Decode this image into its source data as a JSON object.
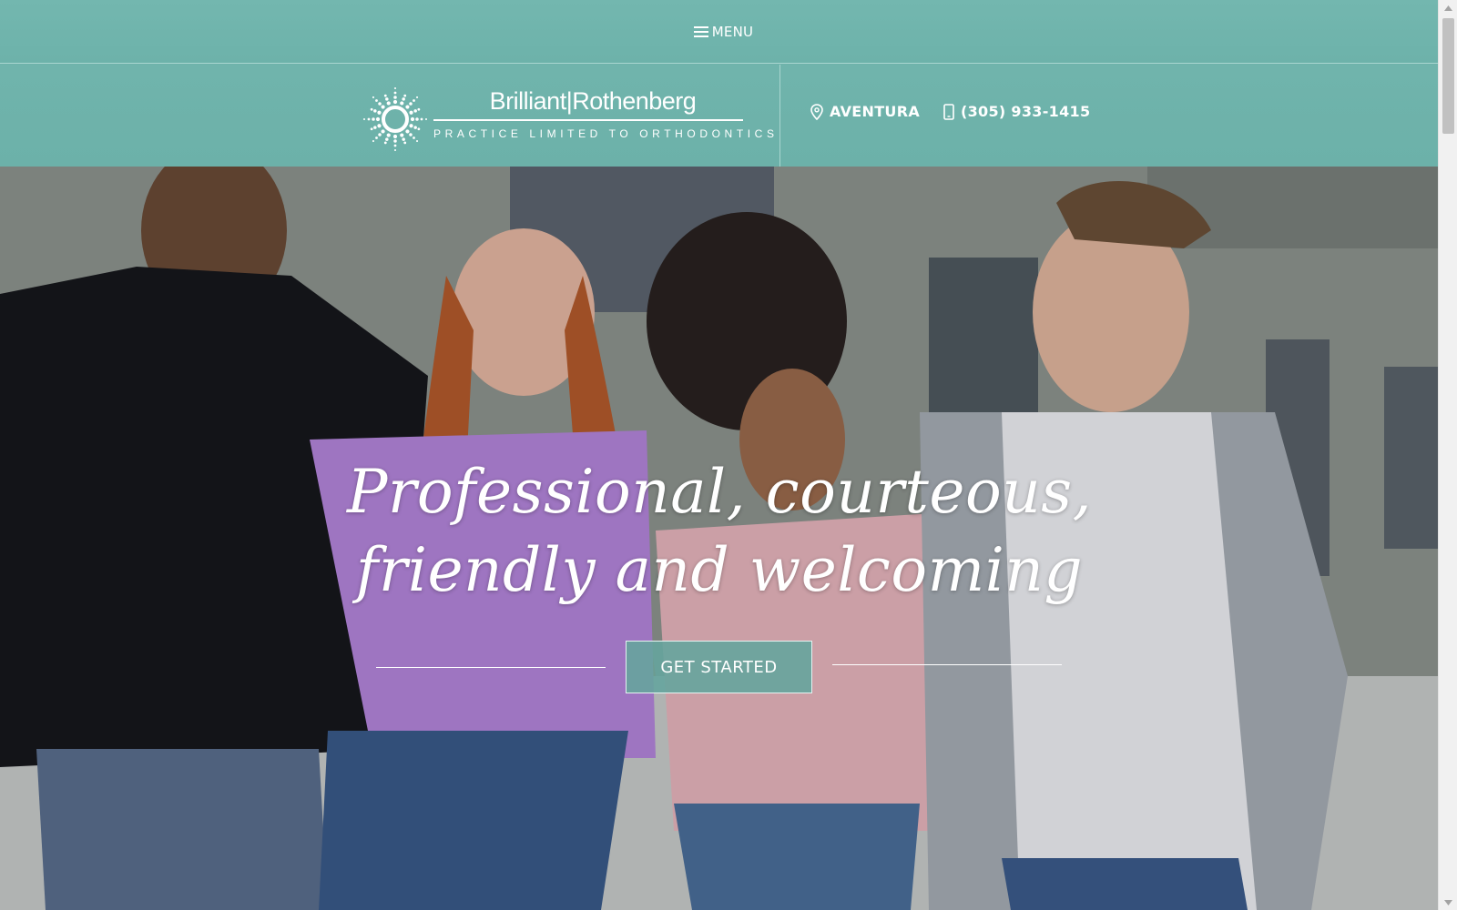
{
  "menu": {
    "label": "MENU",
    "icon": "hamburger-icon"
  },
  "logo": {
    "name": "Brilliant|Rothenberg",
    "tagline": "PRACTICE LIMITED TO ORTHODONTICS",
    "icon": "sun-logo-icon"
  },
  "contact": {
    "location": {
      "icon": "map-pin-icon",
      "label": "AVENTURA"
    },
    "phone": {
      "icon": "mobile-phone-icon",
      "label": "(305) 933-1415"
    }
  },
  "hero": {
    "headline_line1": "Professional, courteous,",
    "headline_line2": "friendly and welcoming",
    "cta_label": "GET STARTED"
  },
  "colors": {
    "brand_teal": "#6fb3ab",
    "button_teal": "#66a49d",
    "text_light": "#ffffff"
  }
}
